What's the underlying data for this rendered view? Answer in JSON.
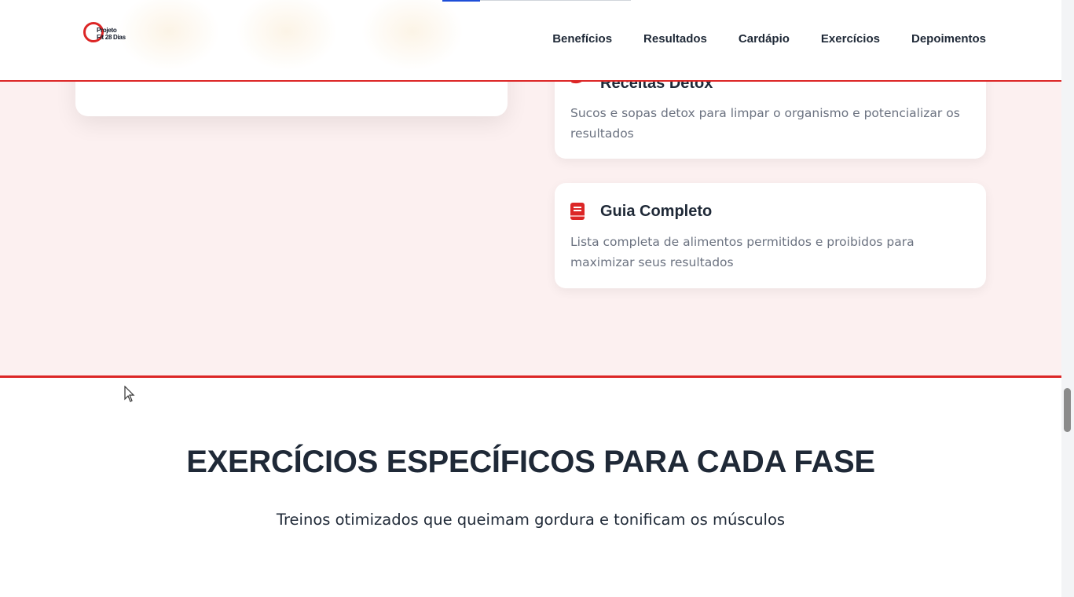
{
  "header": {
    "logo_line1": "Projeto",
    "logo_line2": "Fit 28 Dias",
    "nav": [
      "Benefícios",
      "Resultados",
      "Cardápio",
      "Exercícios",
      "Depoimentos"
    ]
  },
  "features": {
    "detox": {
      "title": "Receitas Detox",
      "description": "Sucos e sopas detox para limpar o organismo e potencializar os resultados",
      "icon": "leaf-icon"
    },
    "guia": {
      "title": "Guia Completo",
      "description": "Lista completa de alimentos permitidos e proibidos para maximizar seus resultados",
      "icon": "book-icon"
    }
  },
  "exercises_section": {
    "title": "EXERCÍCIOS ESPECÍFICOS PARA CADA FASE",
    "subtitle": "Treinos otimizados que queimam gordura e tonificam os músculos"
  },
  "colors": {
    "accent": "#dc2626",
    "section_bg": "#fcf0f0",
    "text_dark": "#1f2937",
    "text_muted": "#6b7280"
  }
}
